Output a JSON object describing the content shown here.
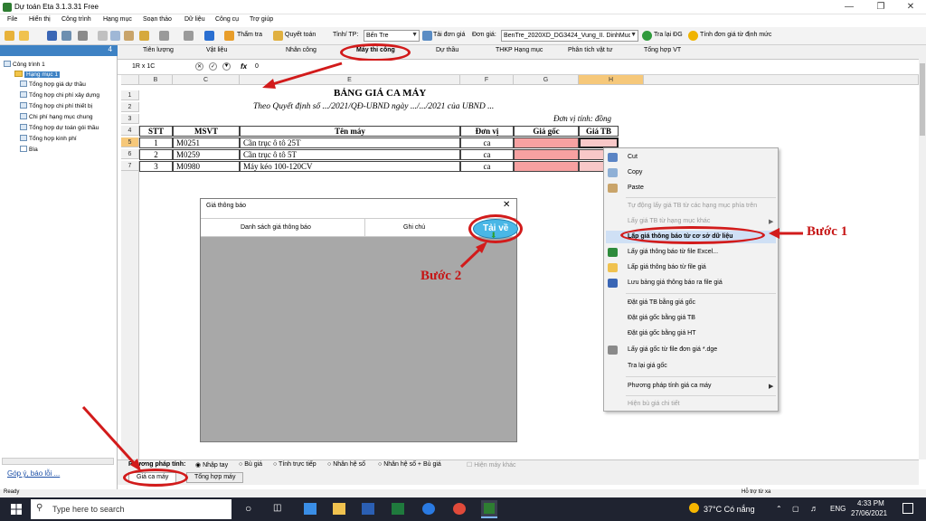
{
  "app": {
    "title": "Dự toán Eta 3.1.3.31 Free"
  },
  "menu": [
    "File",
    "Hiển thị",
    "Công trình",
    "Hạng mục",
    "Soạn thảo",
    "Dữ liệu",
    "Công cụ",
    "Trợ giúp"
  ],
  "toolbar": {
    "tham_tra": "Thẩm tra",
    "quyet_toan": "Quyết toán",
    "province_label": "Tỉnh/ TP:",
    "province_value": "Bến Tre",
    "tai_don_gia": "Tải đơn giá",
    "don_gia_label": "Đơn giá:",
    "don_gia_value": "BenTre_2020XD_DG3424_Vung_II. DinhMuc",
    "tra_lai_dg": "Tra lại ĐG",
    "tinh_don_gia": "Tính đơn giá từ định mức"
  },
  "sidebar": {
    "pin": "4",
    "items": [
      "Công trình 1",
      "Hạng mục 1",
      "Tổng hợp giá dự thầu",
      "Tổng hợp chi phí xây dựng",
      "Tổng hợp chi phí thiết bị",
      "Chi phí hạng mục chung",
      "Tổng hợp dự toán gói thầu",
      "Tổng hợp kinh phí",
      "Bìa"
    ],
    "feedback_link": "Góp ý, báo lỗi ..."
  },
  "tabs": [
    "Tiên lượng",
    "Vật liệu",
    "Nhân công",
    "Máy thi công",
    "Dự thầu",
    "THKP Hạng mục",
    "Phân tích vật tư",
    "Tổng hợp VT"
  ],
  "active_tab": "Máy thi công",
  "formula_bar": {
    "cell_ref": "1R x 1C",
    "fx": "fx",
    "value": "0"
  },
  "sheet": {
    "columns": [
      "B",
      "C",
      "E",
      "F",
      "G",
      "H"
    ],
    "row_numbers": [
      "1",
      "2",
      "3",
      "4",
      "5",
      "6",
      "7"
    ],
    "title": "BẢNG GIÁ CA MÁY",
    "subtitle": "Theo Quyết định số .../2021/QĐ-UBND ngày .../.../2021 của UBND ...",
    "unit": "Đơn vị tính: đồng",
    "headers": [
      "STT",
      "MSVT",
      "Tên máy",
      "Đơn vị",
      "Giá gốc",
      "Giá TB"
    ],
    "rows": [
      {
        "stt": "1",
        "msvt": "M0251",
        "ten": "Cần trục ô tô 25T",
        "dv": "ca"
      },
      {
        "stt": "2",
        "msvt": "M0259",
        "ten": "Cần trục ô tô 5T",
        "dv": "ca"
      },
      {
        "stt": "3",
        "msvt": "M0980",
        "ten": "Máy kéo 100-120CV",
        "dv": "ca"
      }
    ]
  },
  "dialog": {
    "title": "Giá thông báo",
    "col1": "Danh sách giá thông báo",
    "col2": "Ghi chú",
    "download_button": "Tải về"
  },
  "context_menu": {
    "items": [
      "Cut",
      "Copy",
      "Paste",
      "Tự động lấy giá TB từ các hạng mục phía trên",
      "Lấy giá TB từ hạng mục khác",
      "Lấp giá thông báo từ cơ sở dữ liệu",
      "Lấy giá thông báo từ file Excel...",
      "Lấp giá thông báo từ file giá",
      "Lưu bảng giá thông báo ra file giá",
      "Đặt giá TB bằng giá gốc",
      "Đặt giá gốc bằng giá TB",
      "Đặt giá gốc bằng giá HT",
      "Lấy giá gốc từ file đơn giá *.dge",
      "Tra lại giá gốc",
      "Phương pháp tính giá ca máy",
      "Hiện bù giá chi tiết"
    ]
  },
  "annotations": {
    "step1": "Bước 1",
    "step2": "Bước 2"
  },
  "bottom": {
    "method_label": "Phương pháp tính:",
    "options": [
      "Nhập tay",
      "Bù giá",
      "Tính trực tiếp",
      "Nhân hệ số",
      "Nhân hệ số + Bù giá"
    ],
    "checkbox": "Hiện máy khác"
  },
  "sheet_tabs": [
    "Giá ca máy",
    "Tổng hợp máy"
  ],
  "status": {
    "left": "Ready",
    "right": "Hỗ trợ từ xa"
  },
  "taskbar": {
    "search_placeholder": "Type here to search",
    "weather": "37°C Có nắng",
    "lang": "ENG",
    "time": "4:33 PM",
    "date": "27/06/2021"
  },
  "colors": {
    "accent": "#3e82c4",
    "highlight": "#d21b1b",
    "pink": "#f7a1a1"
  }
}
